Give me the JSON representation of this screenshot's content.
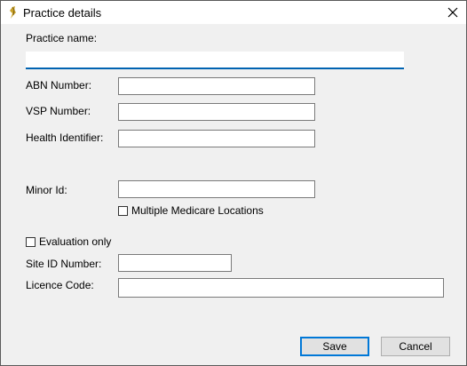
{
  "window": {
    "title": "Practice details"
  },
  "form": {
    "practice_name_label": "Practice name:",
    "practice_name_value": "",
    "abn_label": "ABN Number:",
    "abn_value": "",
    "vsp_label": "VSP Number:",
    "vsp_value": "",
    "health_id_label": "Health Identifier:",
    "health_id_value": "",
    "minor_id_label": "Minor Id:",
    "minor_id_value": "",
    "multiple_medicare_label": "Multiple Medicare Locations",
    "multiple_medicare_checked": false,
    "evaluation_only_label": "Evaluation only",
    "evaluation_only_checked": false,
    "site_id_label": "Site ID Number:",
    "site_id_value": "",
    "licence_code_label": "Licence Code:",
    "licence_code_value": ""
  },
  "buttons": {
    "save": "Save",
    "cancel": "Cancel"
  },
  "colors": {
    "focus_accent": "#0063b1",
    "default_button_border": "#0078d7"
  },
  "icons": {
    "app": "app-feather-icon",
    "close": "close-icon"
  }
}
